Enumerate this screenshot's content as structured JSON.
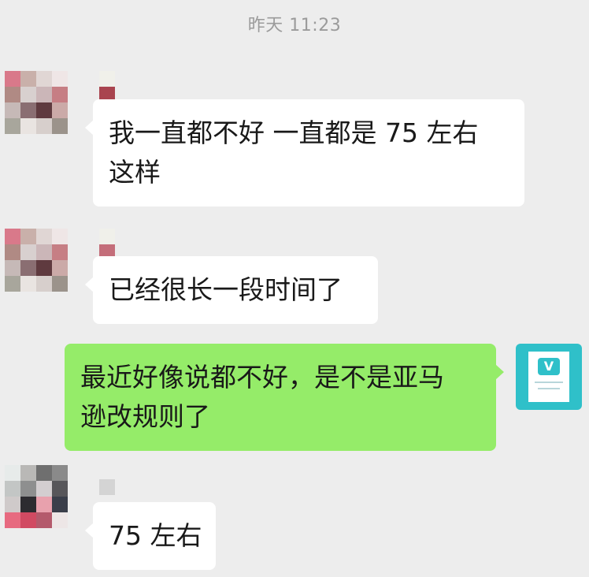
{
  "chat": {
    "timestamp": "昨天 11:23",
    "messages": [
      {
        "sender": "contact",
        "text_lines": [
          "我一直都不好 一直都是 75 左右",
          "这样"
        ]
      },
      {
        "sender": "contact",
        "text_lines": [
          "已经很长一段时间了"
        ]
      },
      {
        "sender": "self",
        "text_lines": [
          "最近好像说都不好，是不是亚马",
          "逊改规则了"
        ]
      },
      {
        "sender": "contact",
        "text_lines": [
          "75 左右"
        ]
      }
    ]
  },
  "avatars": {
    "contact": "pixelated-avatar",
    "self": "v-logo-avatar",
    "self_bg_color": "#2fc0c9"
  },
  "colors": {
    "background": "#ededed",
    "incoming_bubble": "#ffffff",
    "outgoing_bubble": "#95ec69",
    "timestamp_text": "#9b9b9b"
  }
}
